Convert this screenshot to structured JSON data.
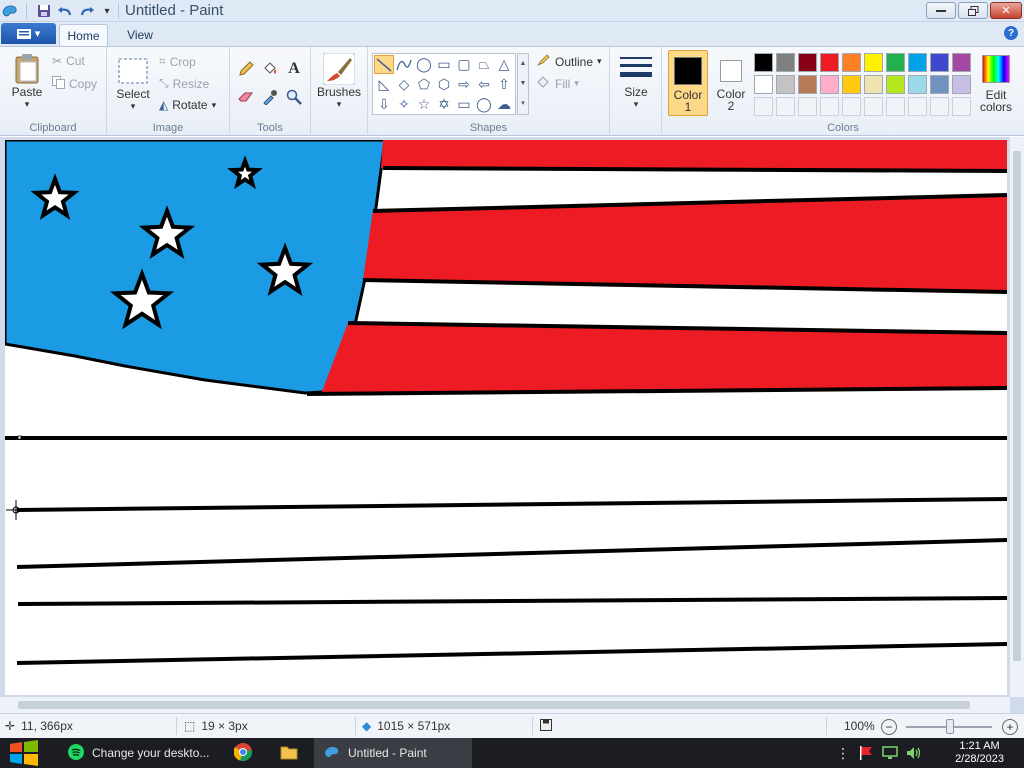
{
  "window": {
    "title": "Untitled - Paint"
  },
  "tabs": [
    {
      "label": "Home",
      "active": true
    },
    {
      "label": "View",
      "active": false
    }
  ],
  "clipboard": {
    "paste": "Paste",
    "cut": "Cut",
    "copy": "Copy",
    "group": "Clipboard"
  },
  "image": {
    "select": "Select",
    "crop": "Crop",
    "resize": "Resize",
    "rotate": "Rotate",
    "group": "Image"
  },
  "tools": {
    "group": "Tools"
  },
  "brushes": {
    "label": "Brushes"
  },
  "shapes": {
    "outline": "Outline",
    "fill": "Fill",
    "group": "Shapes"
  },
  "size": {
    "label": "Size"
  },
  "colors": {
    "color1_label": "Color\n1",
    "color2_label": "Color\n2",
    "color1": "#000000",
    "color2": "#ffffff",
    "edit": "Edit\ncolors",
    "group": "Colors",
    "palette_row1": [
      "#000000",
      "#7f7f7f",
      "#880015",
      "#ed1c24",
      "#ff7f27",
      "#fff200",
      "#22b14c",
      "#00a2e8",
      "#3f48cc",
      "#a349a4"
    ],
    "palette_row2": [
      "#ffffff",
      "#c3c3c3",
      "#b97a57",
      "#ffaec9",
      "#ffc90e",
      "#efe4b0",
      "#b5e61d",
      "#99d9ea",
      "#7092be",
      "#c8bfe7"
    ]
  },
  "drawing_colors": {
    "blue": "#1a9be3",
    "red": "#ed1c24",
    "white": "#ffffff",
    "black": "#000000"
  },
  "status": {
    "cursor_pos": "11, 366px",
    "selection_size": "19 × 3px",
    "image_size": "1015 × 571px",
    "zoom": "100%"
  },
  "taskbar": {
    "items": [
      {
        "label": "Change your deskto...",
        "icon": "spotify-icon"
      },
      {
        "label": "",
        "icon": "chrome-icon"
      },
      {
        "label": "",
        "icon": "folder-icon"
      },
      {
        "label": "Untitled - Paint",
        "icon": "paint-icon",
        "active": true
      }
    ],
    "time": "1:21 AM",
    "date": "2/28/2023"
  }
}
